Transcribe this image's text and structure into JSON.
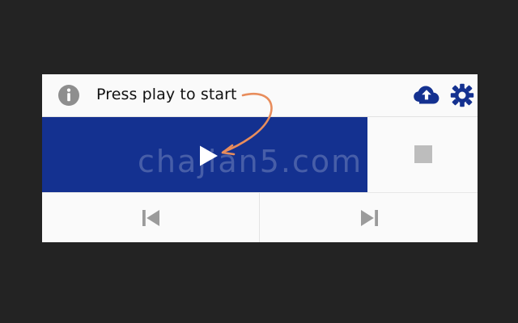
{
  "status": {
    "text": "Press play to start"
  },
  "icons": {
    "info": "info-icon",
    "upload": "cloud-upload-icon",
    "settings": "gear-icon",
    "play": "play-icon",
    "stop": "stop-icon",
    "previous": "skip-previous-icon",
    "next": "skip-next-icon"
  },
  "watermark": {
    "text": "chajian5.com"
  },
  "colors": {
    "primary": "#143190",
    "accent": "#e88d5c",
    "muted_icon": "#9b9b9b"
  }
}
